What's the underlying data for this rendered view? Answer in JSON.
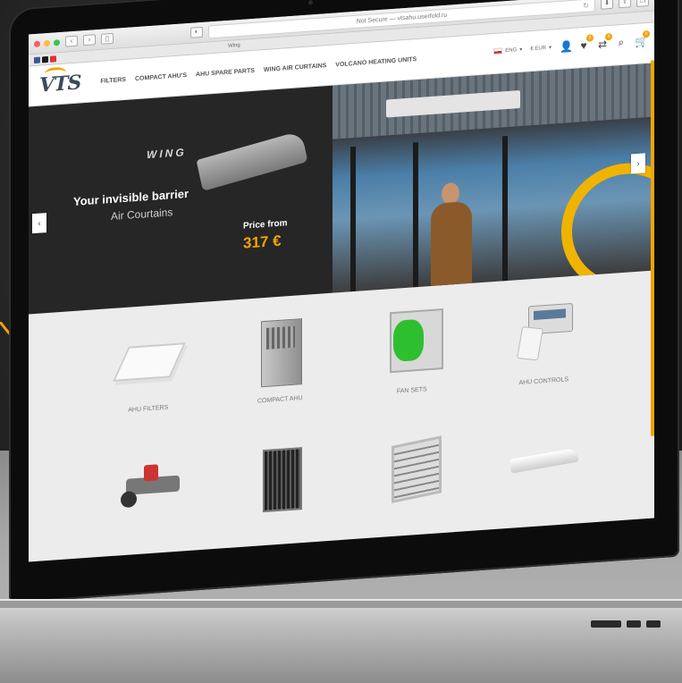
{
  "browser": {
    "address_text": "Not Secure — vtsahu.userfold.ru",
    "tab_title": "Wing"
  },
  "site": {
    "logo_text": "VTS",
    "nav": [
      "FILTERS",
      "COMPACT AHU'S",
      "AHU SPARE PARTS",
      "WING AIR CURTAINS",
      "VOLCANO HEATING UNITS"
    ],
    "language": "ENG",
    "currency": "€ EUR",
    "badges": {
      "wishlist": "0",
      "compare": "0",
      "cart": "0"
    }
  },
  "hero": {
    "brand_word": "WING",
    "tagline": "Your invisible barrier",
    "subtagline": "Air Courtains",
    "price_label": "Price from",
    "price_value": "317 €"
  },
  "categories": [
    {
      "label": "AHU FILTERS",
      "icon": "filters-icon"
    },
    {
      "label": "COMPACT AHU",
      "icon": "compact-ahu-icon"
    },
    {
      "label": "FAN SETS",
      "icon": "fan-set-icon"
    },
    {
      "label": "AHU CONTROLS",
      "icon": "controls-icon"
    },
    {
      "label": "",
      "icon": "valve-icon"
    },
    {
      "label": "",
      "icon": "coil-icon"
    },
    {
      "label": "",
      "icon": "heater-icon"
    },
    {
      "label": "",
      "icon": "air-curtain-icon"
    }
  ],
  "colors": {
    "accent": "#f0a500",
    "hero_dark": "#262626",
    "logo": "#3d4b59"
  }
}
